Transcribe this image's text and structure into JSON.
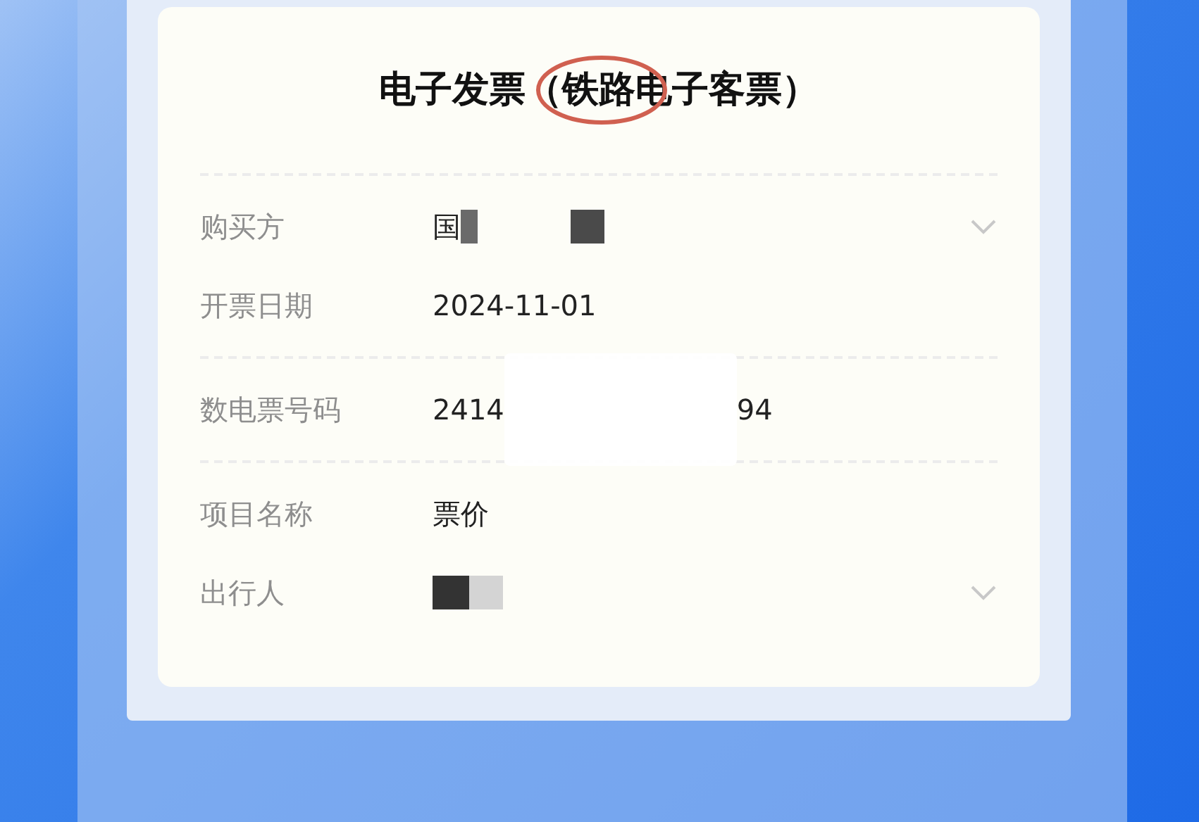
{
  "title": [
    {
      "text": "电子发票（",
      "circled": false
    },
    {
      "text": "铁路",
      "circled": true
    },
    {
      "text": "电子客票）",
      "circled": false
    }
  ],
  "groups": [
    {
      "rows": [
        {
          "label": "购买方",
          "value": "国",
          "redacted": true,
          "value_end": "",
          "expandable": true
        },
        {
          "label": "开票日期",
          "value": "2024-11-01",
          "redacted": false,
          "value_end": "",
          "expandable": false
        }
      ]
    },
    {
      "rows": [
        {
          "label": "数电票号码",
          "value": "2414",
          "redacted": true,
          "value_end": "94",
          "expandable": false
        }
      ]
    },
    {
      "rows": [
        {
          "label": "项目名称",
          "value": "票价",
          "redacted": false,
          "value_end": "",
          "expandable": false
        },
        {
          "label": "出行人",
          "value": "",
          "redacted": true,
          "value_end": "",
          "expandable": true
        }
      ]
    }
  ]
}
